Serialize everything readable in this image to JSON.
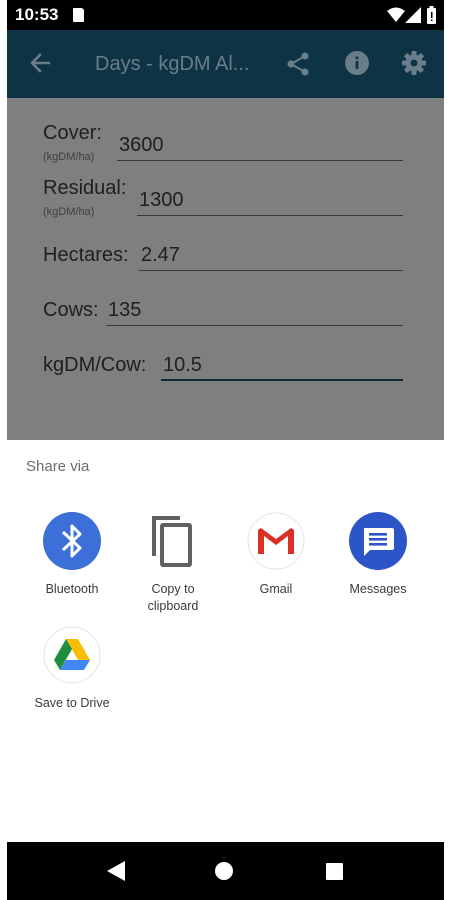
{
  "status_bar": {
    "time": "10:53"
  },
  "toolbar": {
    "title": "Days - kgDM Al..."
  },
  "form": {
    "cover": {
      "label": "Cover:",
      "unit": "(kgDM/ha)",
      "value": "3600"
    },
    "residual": {
      "label": "Residual:",
      "unit": "(kgDM/ha)",
      "value": "1300"
    },
    "hectares": {
      "label": "Hectares:",
      "value": "2.47"
    },
    "cows": {
      "label": "Cows:",
      "value": "135"
    },
    "kgdm_cow": {
      "label": "kgDM/Cow:",
      "value": "10.5"
    }
  },
  "share_sheet": {
    "title": "Share via",
    "targets": [
      {
        "label": "Bluetooth",
        "icon": "bluetooth-icon"
      },
      {
        "label": "Copy to clipboard",
        "icon": "copy-icon"
      },
      {
        "label": "Gmail",
        "icon": "gmail-icon"
      },
      {
        "label": "Messages",
        "icon": "messages-icon"
      },
      {
        "label": "Save to Drive",
        "icon": "drive-icon"
      }
    ]
  },
  "colors": {
    "toolbar": "#0d3344",
    "overlay": "#7f7f7f",
    "bluetooth": "#3d6fd8",
    "messages": "#2c56c8"
  }
}
